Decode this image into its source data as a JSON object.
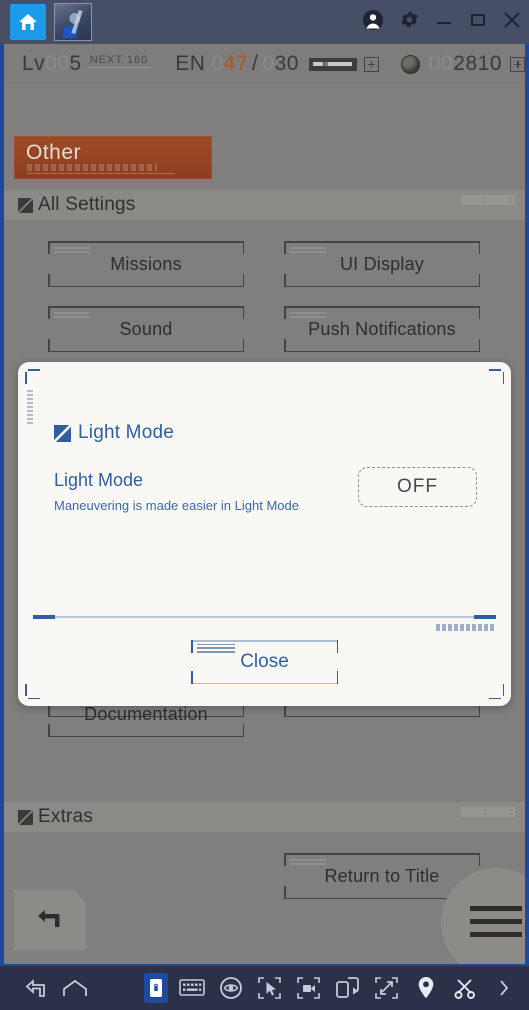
{
  "titlebar": {
    "tabs": [
      {
        "name": "home-tab",
        "label": ""
      },
      {
        "name": "game-tab",
        "label": ""
      }
    ],
    "buttons": [
      {
        "name": "account-button",
        "icon": "account-icon",
        "label": ""
      },
      {
        "name": "settings-button",
        "icon": "gear-icon",
        "label": ""
      },
      {
        "name": "minimize-button",
        "icon": "minimize-icon",
        "label": ""
      },
      {
        "name": "maximize-button",
        "icon": "maximize-icon",
        "label": ""
      },
      {
        "name": "close-button",
        "icon": "close-icon",
        "label": ""
      }
    ]
  },
  "status": {
    "lv_label": "Lv",
    "lv_pad": "00",
    "lv_value": "5",
    "next_label": "NEXT",
    "next_value": "160",
    "en_label": "EN",
    "en_pad": "0",
    "en_value": "47",
    "en_sep": "/",
    "en_max_pad": "0",
    "en_max": "30",
    "currency_pad": "00",
    "currency_value": "2810"
  },
  "banner": {
    "title": "Other"
  },
  "sections": [
    {
      "name": "all-settings",
      "label": "All Settings",
      "buttons": [
        {
          "name": "missions-button",
          "label": "Missions"
        },
        {
          "name": "ui-display-button",
          "label": "UI Display"
        },
        {
          "name": "sound-button",
          "label": "Sound"
        },
        {
          "name": "push-notifications-button",
          "label": "Push Notifications"
        },
        {
          "name": "documentation-button",
          "label": "Documentation"
        }
      ]
    },
    {
      "name": "extras",
      "label": "Extras",
      "buttons": [
        {
          "name": "return-to-title-button",
          "label": "Return to Title"
        }
      ]
    }
  ],
  "dialog": {
    "header": "Light Mode",
    "row_label": "Light Mode",
    "row_description": "Maneuvering is made easier in Light Mode",
    "toggle_value": "OFF",
    "close_label": "Close",
    "accent_color": "#2f5f9e",
    "background_color": "#faf8f5"
  },
  "game_controls": {
    "back_button": "back-arrow-icon",
    "menu_button": "hamburger-menu-icon"
  },
  "navbar": {
    "icons": [
      {
        "name": "nav-back-icon",
        "label": ""
      },
      {
        "name": "nav-home-icon",
        "label": ""
      },
      {
        "name": "nav-phone-lock-icon",
        "label": ""
      },
      {
        "name": "nav-keyboard-icon",
        "label": ""
      },
      {
        "name": "nav-eye-icon",
        "label": ""
      },
      {
        "name": "nav-cursor-icon",
        "label": ""
      },
      {
        "name": "nav-record-icon",
        "label": ""
      },
      {
        "name": "nav-multi-instance-icon",
        "label": ""
      },
      {
        "name": "nav-fullscreen-icon",
        "label": ""
      },
      {
        "name": "nav-location-icon",
        "label": ""
      },
      {
        "name": "nav-scissors-icon",
        "label": ""
      },
      {
        "name": "nav-more-icon",
        "label": ""
      }
    ]
  }
}
